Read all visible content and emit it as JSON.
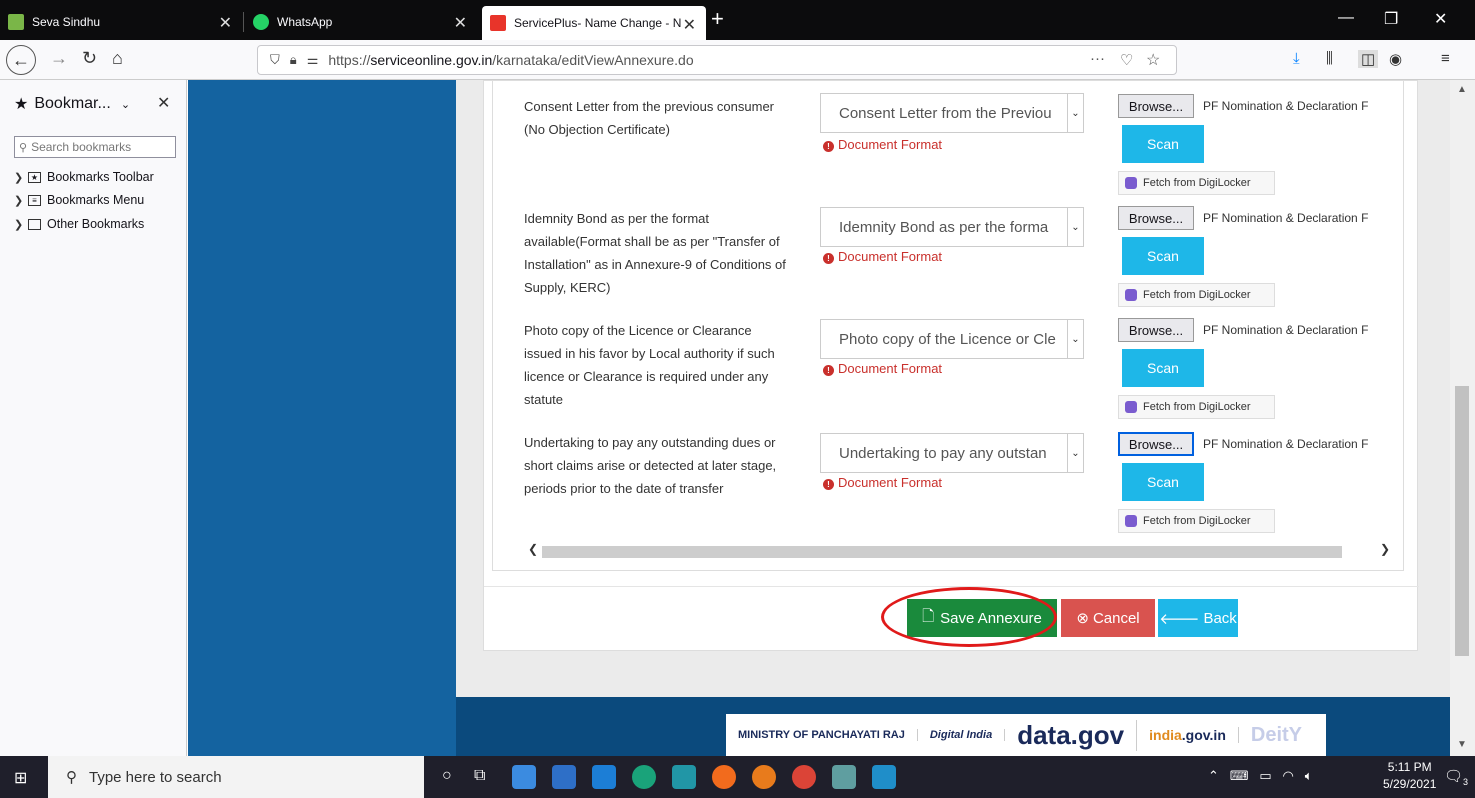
{
  "tabs": [
    {
      "title": "Seva Sindhu",
      "active": false
    },
    {
      "title": "WhatsApp",
      "active": false
    },
    {
      "title": "ServicePlus- Name Change - N",
      "active": true
    }
  ],
  "nav": {
    "url_prefix": "https://",
    "url_domain": "serviceonline.gov.in",
    "url_path": "/karnataka/editViewAnnexure.do"
  },
  "sidebar": {
    "title": "Bookmar...",
    "search_placeholder": "Search bookmarks",
    "items": [
      {
        "label": "Bookmarks Toolbar"
      },
      {
        "label": "Bookmarks Menu"
      },
      {
        "label": "Other Bookmarks"
      }
    ]
  },
  "documents": [
    {
      "desc": "Consent Letter from the previous consumer (No Objection Certificate)",
      "selected": "Consent Letter from the Previou",
      "format_label": "Document Format",
      "browse_label": "Browse...",
      "file_name": "PF Nomination & Declaration F",
      "scan_label": "Scan",
      "digilocker_label": "Fetch from DigiLocker"
    },
    {
      "desc": "Idemnity Bond as per the format available(Format shall be as per \"Transfer of Installation\" as in Annexure-9 of Conditions of Supply, KERC)",
      "selected": "Idemnity Bond as per the forma",
      "format_label": "Document Format",
      "browse_label": "Browse...",
      "file_name": "PF Nomination & Declaration F",
      "scan_label": "Scan",
      "digilocker_label": "Fetch from DigiLocker"
    },
    {
      "desc": "Photo copy of the Licence or Clearance issued in his favor by Local authority if such licence or Clearance is required under any statute",
      "selected": "Photo copy of the Licence or Cle",
      "format_label": "Document Format",
      "browse_label": "Browse...",
      "file_name": "PF Nomination & Declaration F",
      "scan_label": "Scan",
      "digilocker_label": "Fetch from DigiLocker"
    },
    {
      "desc": "Undertaking to pay any outstanding dues or short claims arise or detected at later stage, periods prior to the date of transfer",
      "selected": "Undertaking to pay any outstan",
      "format_label": "Document Format",
      "browse_label": "Browse...",
      "file_name": "PF Nomination & Declaration F",
      "scan_label": "Scan",
      "digilocker_label": "Fetch from DigiLocker"
    }
  ],
  "actions": {
    "save_label": "Save Annexure",
    "cancel_label": "Cancel",
    "back_label": "Back"
  },
  "footer": {
    "ministry": "MINISTRY OF PANCHAYATI RAJ",
    "digital_india": "Digital India",
    "datagov": "data.gov",
    "indiagov": ".gov.in",
    "india_label": "india",
    "deity": "DeitY"
  },
  "taskbar": {
    "search_placeholder": "Type here to search",
    "time": "5:11 PM",
    "date": "5/29/2021",
    "notif_count": "3"
  },
  "colors": {
    "save": "#1a8a3c",
    "cancel": "#d9534f",
    "scan": "#1eb7e8",
    "left_panel": "#1463a0",
    "highlight": "#e01a1a"
  }
}
